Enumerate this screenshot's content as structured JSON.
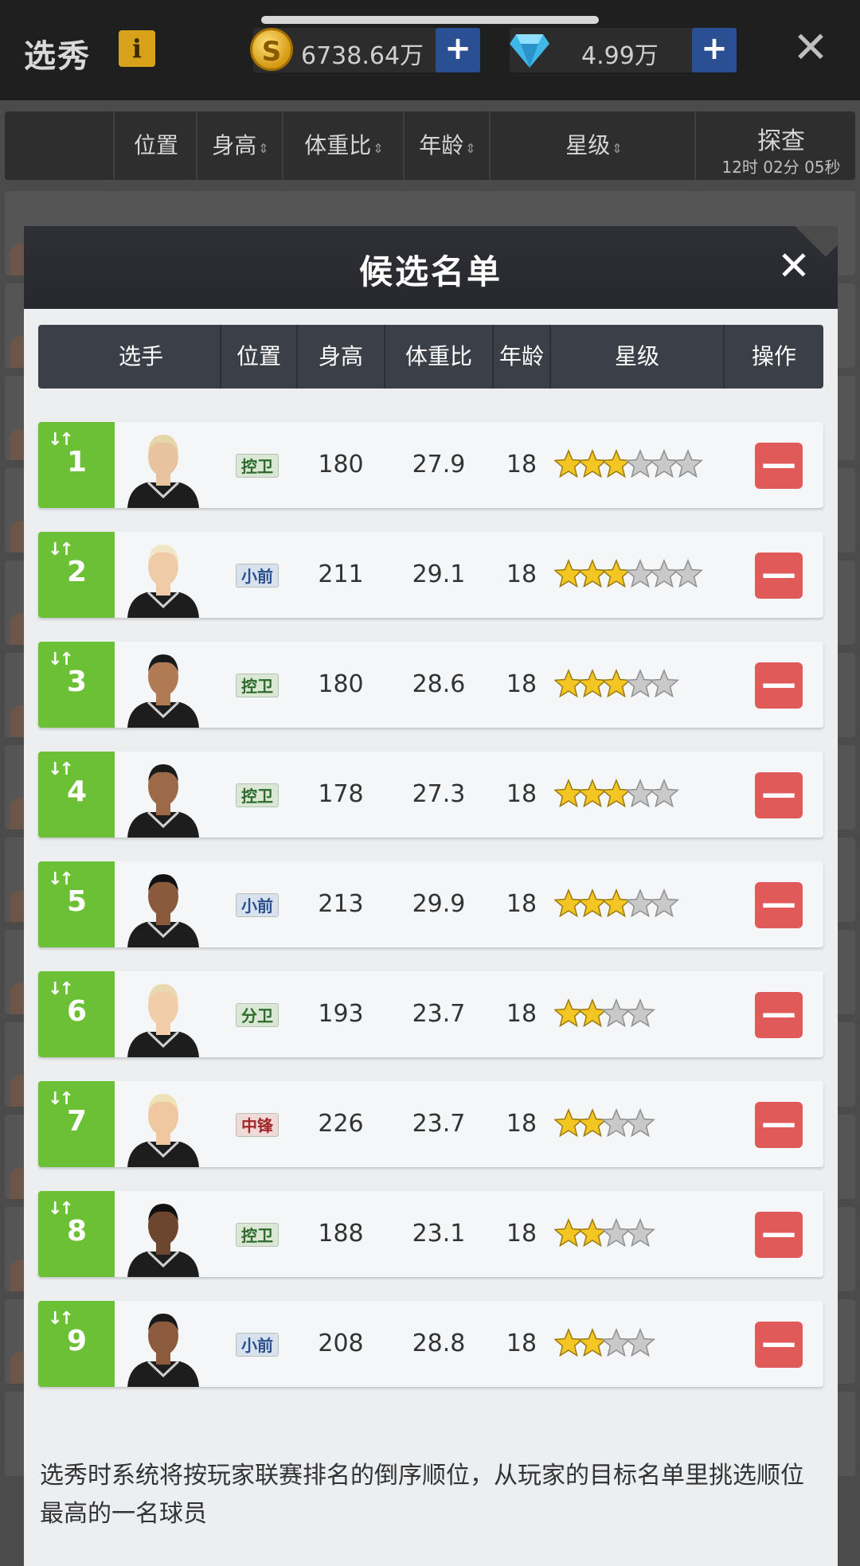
{
  "topbar": {
    "title": "选秀",
    "info_label": "i",
    "coins": {
      "icon": "coin-icon",
      "value": "6738.64万",
      "plus": "+"
    },
    "gems": {
      "icon": "diamond-icon",
      "value": "4.99万",
      "plus": "+"
    },
    "close": "✕"
  },
  "background_list": {
    "columns": [
      "位置",
      "身高",
      "体重比",
      "年龄",
      "星级"
    ],
    "scout_title": "探查",
    "scout_time": "12时 02分 05秒"
  },
  "modal": {
    "title": "候选名单",
    "close": "✕",
    "columns": [
      "选手",
      "位置",
      "身高",
      "体重比",
      "年龄",
      "星级",
      "操作"
    ],
    "remove_label": "—",
    "players": [
      {
        "rank": "1",
        "position": "控卫",
        "pos_type": "g",
        "height": "180",
        "weight_ratio": "27.9",
        "age": "18",
        "stars": 3,
        "max_stars": 6
      },
      {
        "rank": "2",
        "position": "小前",
        "pos_type": "f",
        "height": "211",
        "weight_ratio": "29.1",
        "age": "18",
        "stars": 3,
        "max_stars": 6
      },
      {
        "rank": "3",
        "position": "控卫",
        "pos_type": "g",
        "height": "180",
        "weight_ratio": "28.6",
        "age": "18",
        "stars": 3,
        "max_stars": 5
      },
      {
        "rank": "4",
        "position": "控卫",
        "pos_type": "g",
        "height": "178",
        "weight_ratio": "27.3",
        "age": "18",
        "stars": 3,
        "max_stars": 5
      },
      {
        "rank": "5",
        "position": "小前",
        "pos_type": "f",
        "height": "213",
        "weight_ratio": "29.9",
        "age": "18",
        "stars": 3,
        "max_stars": 5
      },
      {
        "rank": "6",
        "position": "分卫",
        "pos_type": "g",
        "height": "193",
        "weight_ratio": "23.7",
        "age": "18",
        "stars": 2,
        "max_stars": 4
      },
      {
        "rank": "7",
        "position": "中锋",
        "pos_type": "c",
        "height": "226",
        "weight_ratio": "23.7",
        "age": "18",
        "stars": 2,
        "max_stars": 4
      },
      {
        "rank": "8",
        "position": "控卫",
        "pos_type": "g",
        "height": "188",
        "weight_ratio": "23.1",
        "age": "18",
        "stars": 2,
        "max_stars": 4
      },
      {
        "rank": "9",
        "position": "小前",
        "pos_type": "f",
        "height": "208",
        "weight_ratio": "28.8",
        "age": "18",
        "stars": 2,
        "max_stars": 4
      }
    ],
    "footer_text": "选秀时系统将按玩家联赛排名的倒序顺位，从玩家的目标名单里挑选顺位最高的一名球员"
  },
  "colors": {
    "rank_tab": "#6cc035",
    "remove_button": "#e15a5a",
    "header_bg": "#3b3f48",
    "star_filled": "#f3c623",
    "star_empty": "#c9c9c9"
  }
}
